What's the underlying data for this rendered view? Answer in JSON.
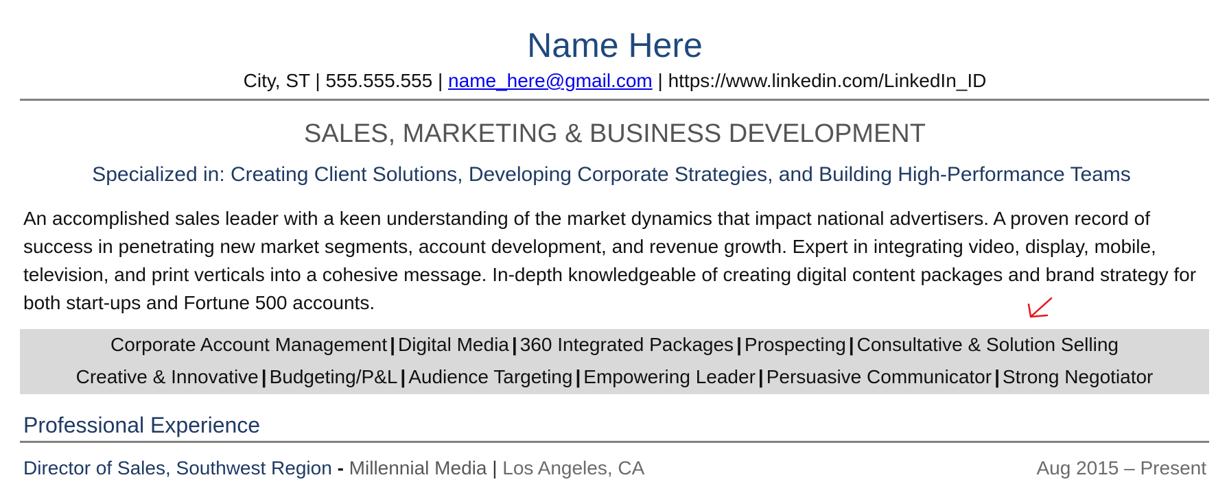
{
  "header": {
    "name": "Name Here",
    "contact": {
      "location": "City, ST",
      "phone": "555.555.555",
      "email": "name_here@gmail.com",
      "linkedin": "https://www.linkedin.com/LinkedIn_ID",
      "separator": "|"
    }
  },
  "headline": "SALES, MARKETING & BUSINESS DEVELOPMENT",
  "specialized": "Specialized in: Creating Client Solutions, Developing Corporate Strategies, and Building High-Performance Teams",
  "summary": "An accomplished sales leader with a keen understanding of the market dynamics that impact national advertisers. A proven record of success in penetrating new market segments, account development, and revenue growth. Expert in integrating video, display, mobile, television, and print verticals into a cohesive message. In-depth knowledgeable of creating digital content packages and brand strategy for both start-ups and Fortune 500 accounts.",
  "annotation": {
    "icon": "red-arrow-down-left",
    "color": "#e8141c"
  },
  "skills": {
    "separator": "|",
    "rows": [
      [
        "Corporate Account Management",
        "Digital Media",
        "360 Integrated Packages",
        "Prospecting",
        "Consultative & Solution Selling"
      ],
      [
        "Creative & Innovative",
        "Budgeting/P&L",
        "Audience Targeting",
        "Empowering Leader",
        "Persuasive Communicator",
        "Strong Negotiator"
      ]
    ]
  },
  "experience": {
    "section_title": "Professional Experience",
    "jobs": [
      {
        "title": "Director of Sales, Southwest Region",
        "dash": "-",
        "company": "Millennial Media",
        "separator": "|",
        "location": "Los Angeles, CA",
        "dates": "Aug 2015 – Present"
      }
    ]
  },
  "colors": {
    "name": "#1f497d",
    "heading_blue": "#1f3a64",
    "rule": "#808080",
    "skills_bg": "#d9d9d9",
    "link": "#0000ee"
  }
}
